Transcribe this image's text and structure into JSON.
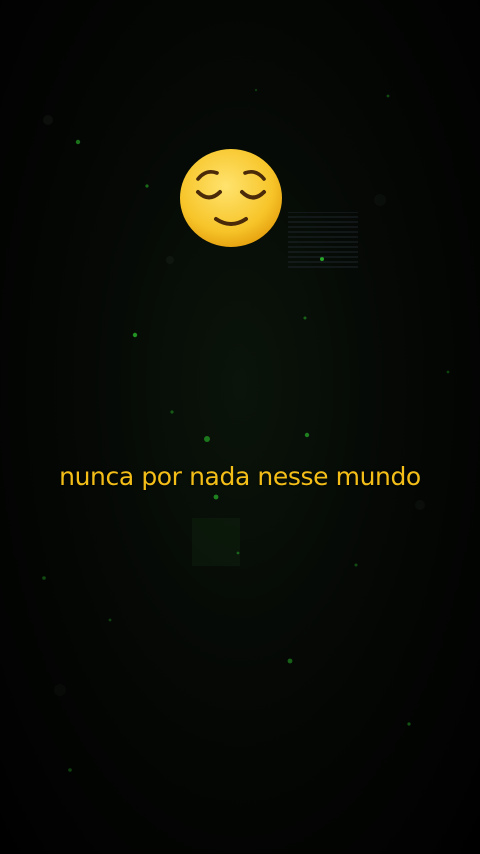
{
  "screen": {
    "background_color": "#000000",
    "particle_color": "#2ecc2e",
    "emoji": {
      "icon": "relieved-face-emoji",
      "face_color": "#f7c52a",
      "feature_color": "#4a2a08"
    },
    "caption": {
      "text": "nunca por nada nesse mundo",
      "color": "#f3be18"
    }
  }
}
